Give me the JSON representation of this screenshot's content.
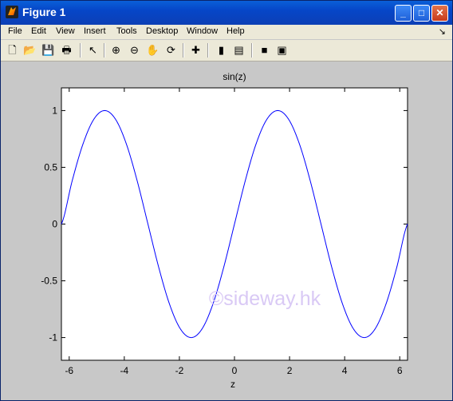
{
  "window": {
    "title": "Figure 1",
    "controls": [
      "minimize",
      "maximize",
      "close"
    ]
  },
  "menubar": {
    "items": [
      "File",
      "Edit",
      "View",
      "Insert",
      "Tools",
      "Desktop",
      "Window",
      "Help"
    ]
  },
  "toolbar": {
    "tools": [
      "new-figure-icon",
      "open-file-icon",
      "save-icon",
      "print-icon",
      "pointer-icon",
      "zoom-in-icon",
      "zoom-out-icon",
      "pan-hand-icon",
      "rotate-3d-icon",
      "data-cursor-icon",
      "colorbar-icon",
      "legend-icon",
      "hide-plot-tools-icon",
      "show-plot-tools-icon"
    ]
  },
  "watermark": "©sideway.hk",
  "chart_data": {
    "type": "line",
    "title": "sin(z)",
    "xlabel": "z",
    "ylabel": "",
    "xlim": [
      -6.2832,
      6.2832
    ],
    "ylim": [
      -1.2,
      1.2
    ],
    "xticks": [
      "-6",
      "-4",
      "-2",
      "0",
      "2",
      "4",
      "6"
    ],
    "yticks": [
      "1",
      "0.5",
      "0",
      "-0.5",
      "-1"
    ],
    "grid": false,
    "series": [
      {
        "color": "#0000ff",
        "x": [
          -6.2832,
          -5.8905,
          -5.4978,
          -5.1051,
          -4.7124,
          -4.3197,
          -3.927,
          -3.5343,
          -3.1416,
          -2.7489,
          -2.3562,
          -1.9635,
          -1.5708,
          -1.1781,
          -0.7854,
          -0.3927,
          0,
          0.3927,
          0.7854,
          1.1781,
          1.5708,
          1.9635,
          2.3562,
          2.7489,
          3.1416,
          3.5343,
          3.927,
          4.3197,
          4.7124,
          5.1051,
          5.4978,
          5.8905,
          6.2832
        ],
        "y": [
          0,
          0.3827,
          0.7071,
          0.9239,
          1,
          0.9239,
          0.7071,
          0.3827,
          0,
          -0.3827,
          -0.7071,
          -0.9239,
          -1,
          -0.9239,
          -0.7071,
          -0.3827,
          0,
          0.3827,
          0.7071,
          0.9239,
          1,
          0.9239,
          0.7071,
          0.3827,
          0,
          -0.3827,
          -0.7071,
          -0.9239,
          -1,
          -0.9239,
          -0.7071,
          -0.3827,
          0
        ]
      }
    ]
  }
}
